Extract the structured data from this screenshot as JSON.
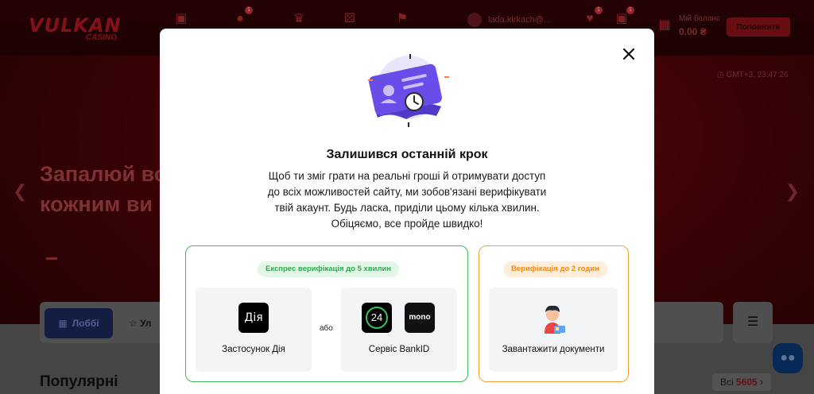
{
  "site": {
    "logo_main": "VULKAN",
    "logo_sub": "CASINO",
    "header_badge_count": "1",
    "user_name": "lada.kirkach@...",
    "balance_label": "Мій баланс",
    "balance_value": "0.00 ₴",
    "topup_label": "Поповнити",
    "clock": "GMT+3, 23:47:26",
    "hero_line1": "Запалюй во",
    "hero_line2": "кожним ви",
    "lobby_label": "Лоббі",
    "fav_label": "Ул",
    "popular_heading": "Популярні",
    "all_label": "Всі",
    "all_count": "5605"
  },
  "modal": {
    "title": "Залишився останній крок",
    "text_lines": [
      "Щоб ти зміг грати на реальні гроші й отримувати доступ",
      "до всіх можливостей сайту, ми зобов'язані верифікувати",
      "твій акаунт. Будь ласка, приділи цьому кілька хвилин.",
      "Обіцяємо, все пройде швидко!"
    ],
    "express": {
      "badge": "Експрес верифікація до 5 хвилин",
      "option_diya_logo": "Дія",
      "option_diya_label": "Застосунок Дія",
      "or_label": "або",
      "option_bankid_logo_1": "24",
      "option_bankid_logo_2": "mono",
      "option_bankid_label": "Сервіс BankID"
    },
    "standard": {
      "badge": "Верифікація до 2 годин",
      "option_docs_label": "Завантажити документи"
    }
  },
  "colors": {
    "express_border": "#3dbb5d",
    "standard_border": "#f3a23a",
    "illustration_card": "#6a4de8",
    "lobby_button": "#1f2d66"
  }
}
